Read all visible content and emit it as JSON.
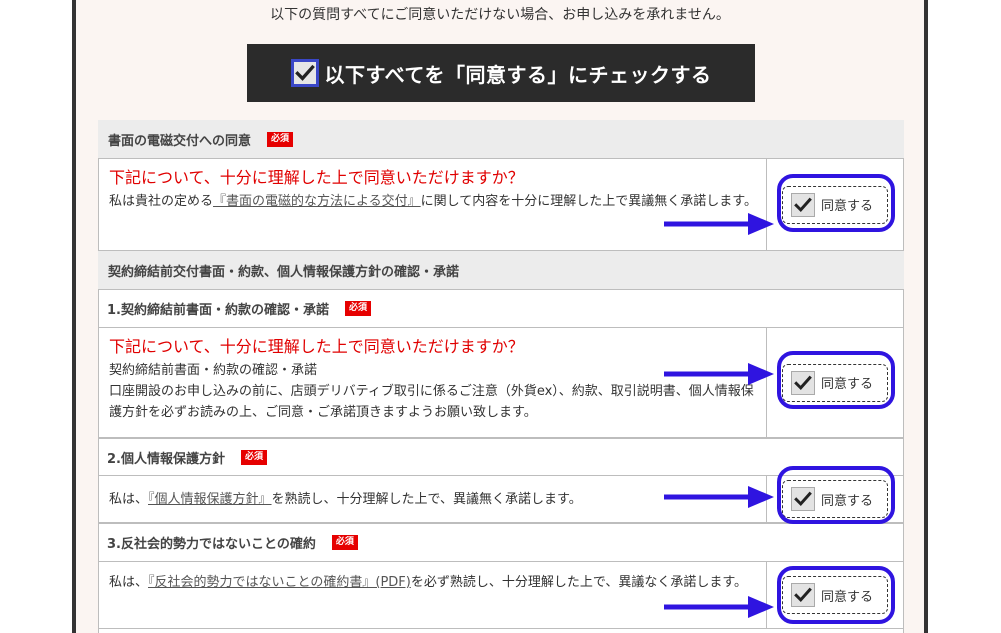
{
  "notice": "以下の質問すべてにご同意いただけない場合、お申し込みを承れません。",
  "agree_all_label": "以下すべてを「同意する」にチェックする",
  "required_badge": "必須",
  "checkbox_label": "同意する",
  "question": "下記について、十分に理解した上で同意いただけますか？",
  "sections": {
    "electronic": {
      "title": "書面の電磁交付への同意",
      "text_pre": "私は貴社の定める",
      "link": "『書面の電磁的な方法による交付』",
      "text_post": "に関して内容を十分に理解した上で異議無く承諾します。"
    },
    "contract": {
      "title": "契約締結前交付書面・約款、個人情報保護方針の確認・承諾",
      "item1": {
        "title": "1.契約締結前書面・約款の確認・承諾",
        "line1": "契約締結前書面・約款の確認・承諾",
        "line2": "口座開設のお申し込みの前に、店頭デリバティブ取引に係るご注意（外貨ex）、約款、取引説明書、個人情報保護方針を必ずお読みの上、ご同意・ご承諾頂きますようお願い致します。"
      },
      "item2": {
        "title": "2.個人情報保護方針",
        "text_pre": "私は、",
        "link": "『個人情報保護方針』",
        "text_post": "を熟読し、十分理解した上で、異議無く承諾します。"
      },
      "item3": {
        "title": "3.反社会的勢力ではないことの確約",
        "text_pre": "私は、",
        "link": "『反社会的勢力ではないことの確約書』(PDF)",
        "text_post": "を必ず熟読し、十分理解した上で、異議なく承諾します。"
      }
    }
  },
  "colors": {
    "highlight": "#2f14e0",
    "badge": "#e60000",
    "question": "#e00000"
  }
}
